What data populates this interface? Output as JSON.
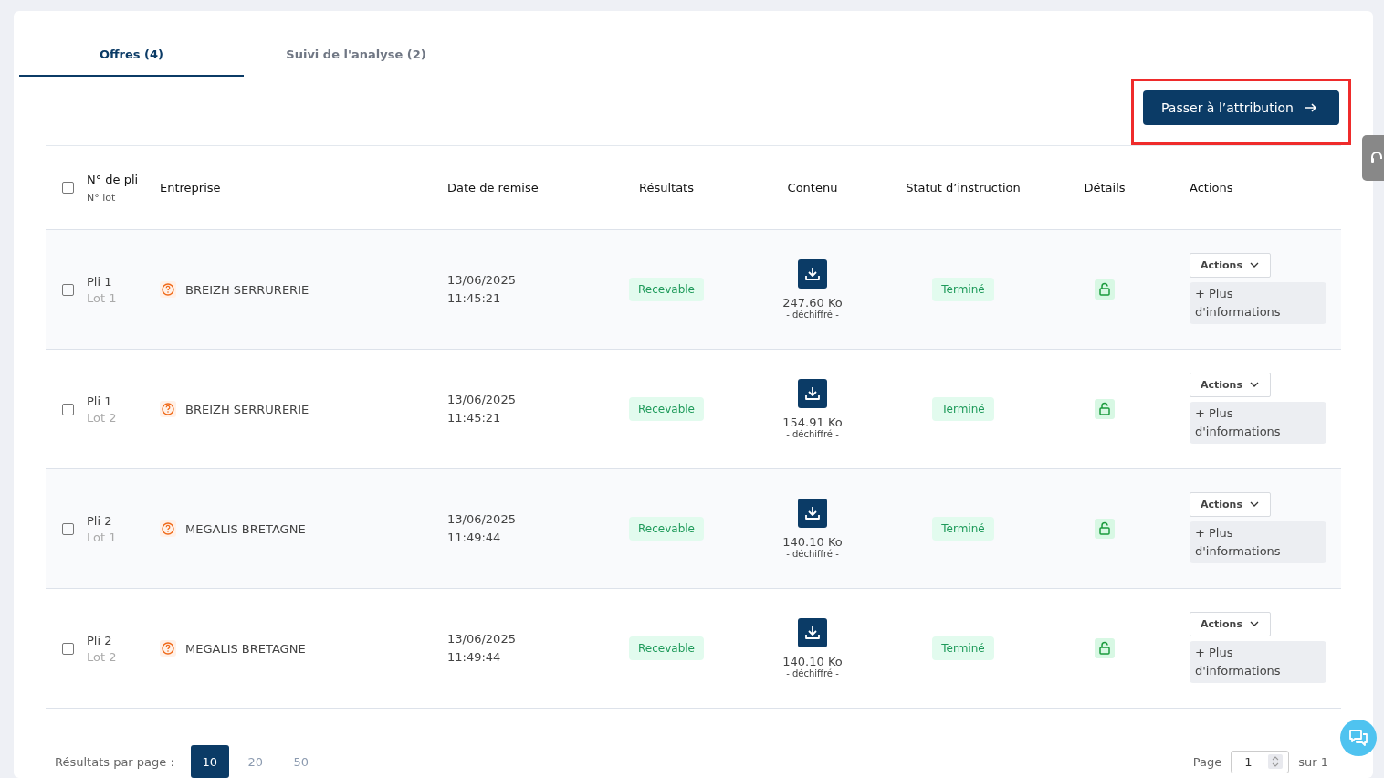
{
  "tabs": [
    {
      "label": "Offres (4)",
      "selected": true
    },
    {
      "label": "Suivi de l'analyse (2)",
      "selected": false
    }
  ],
  "primary_button": {
    "label": "Passer à l’attribution",
    "highlighted": true
  },
  "table": {
    "all_checked": false,
    "columns": [
      {
        "label": "N° de pli",
        "sublabel": "N° lot"
      },
      {
        "label": "Entreprise"
      },
      {
        "label": "Date de remise"
      },
      {
        "label": "Résultats"
      },
      {
        "label": "Contenu"
      },
      {
        "label": "Statut d’instruction"
      },
      {
        "label": "Détails"
      },
      {
        "label": "Actions"
      }
    ],
    "rows": [
      {
        "checked": false,
        "pli": "Pli 1",
        "lot": "Lot 1",
        "company": "BREIZH SERRURERIE",
        "date": "13/06/2025",
        "time": "11:45:21",
        "result": "Recevable",
        "size": "247.60 Ko",
        "note": "- déchiffré -",
        "status": "Terminé",
        "actions": "Actions",
        "more": "+ Plus d'informations"
      },
      {
        "checked": false,
        "pli": "Pli 1",
        "lot": "Lot 2",
        "company": "BREIZH SERRURERIE",
        "date": "13/06/2025",
        "time": "11:45:21",
        "result": "Recevable",
        "size": "154.91 Ko",
        "note": "- déchiffré -",
        "status": "Terminé",
        "actions": "Actions",
        "more": "+ Plus d'informations"
      },
      {
        "checked": false,
        "pli": "Pli 2",
        "lot": "Lot 1",
        "company": "MEGALIS BRETAGNE",
        "date": "13/06/2025",
        "time": "11:49:44",
        "result": "Recevable",
        "size": "140.10 Ko",
        "note": "- déchiffré -",
        "status": "Terminé",
        "actions": "Actions",
        "more": "+ Plus d'informations"
      },
      {
        "checked": false,
        "pli": "Pli 2",
        "lot": "Lot 2",
        "company": "MEGALIS BRETAGNE",
        "date": "13/06/2025",
        "time": "11:49:44",
        "result": "Recevable",
        "size": "140.10 Ko",
        "note": "- déchiffré -",
        "status": "Terminé",
        "actions": "Actions",
        "more": "+ Plus d'informations"
      }
    ]
  },
  "footer": {
    "per_page_label": "Résultats par page :",
    "per_page_options": [
      {
        "label": "10",
        "selected": true
      },
      {
        "label": "20",
        "selected": false
      },
      {
        "label": "50",
        "selected": false
      }
    ],
    "page_label": "Page",
    "page_value": "1",
    "page_total": "sur 1"
  }
}
